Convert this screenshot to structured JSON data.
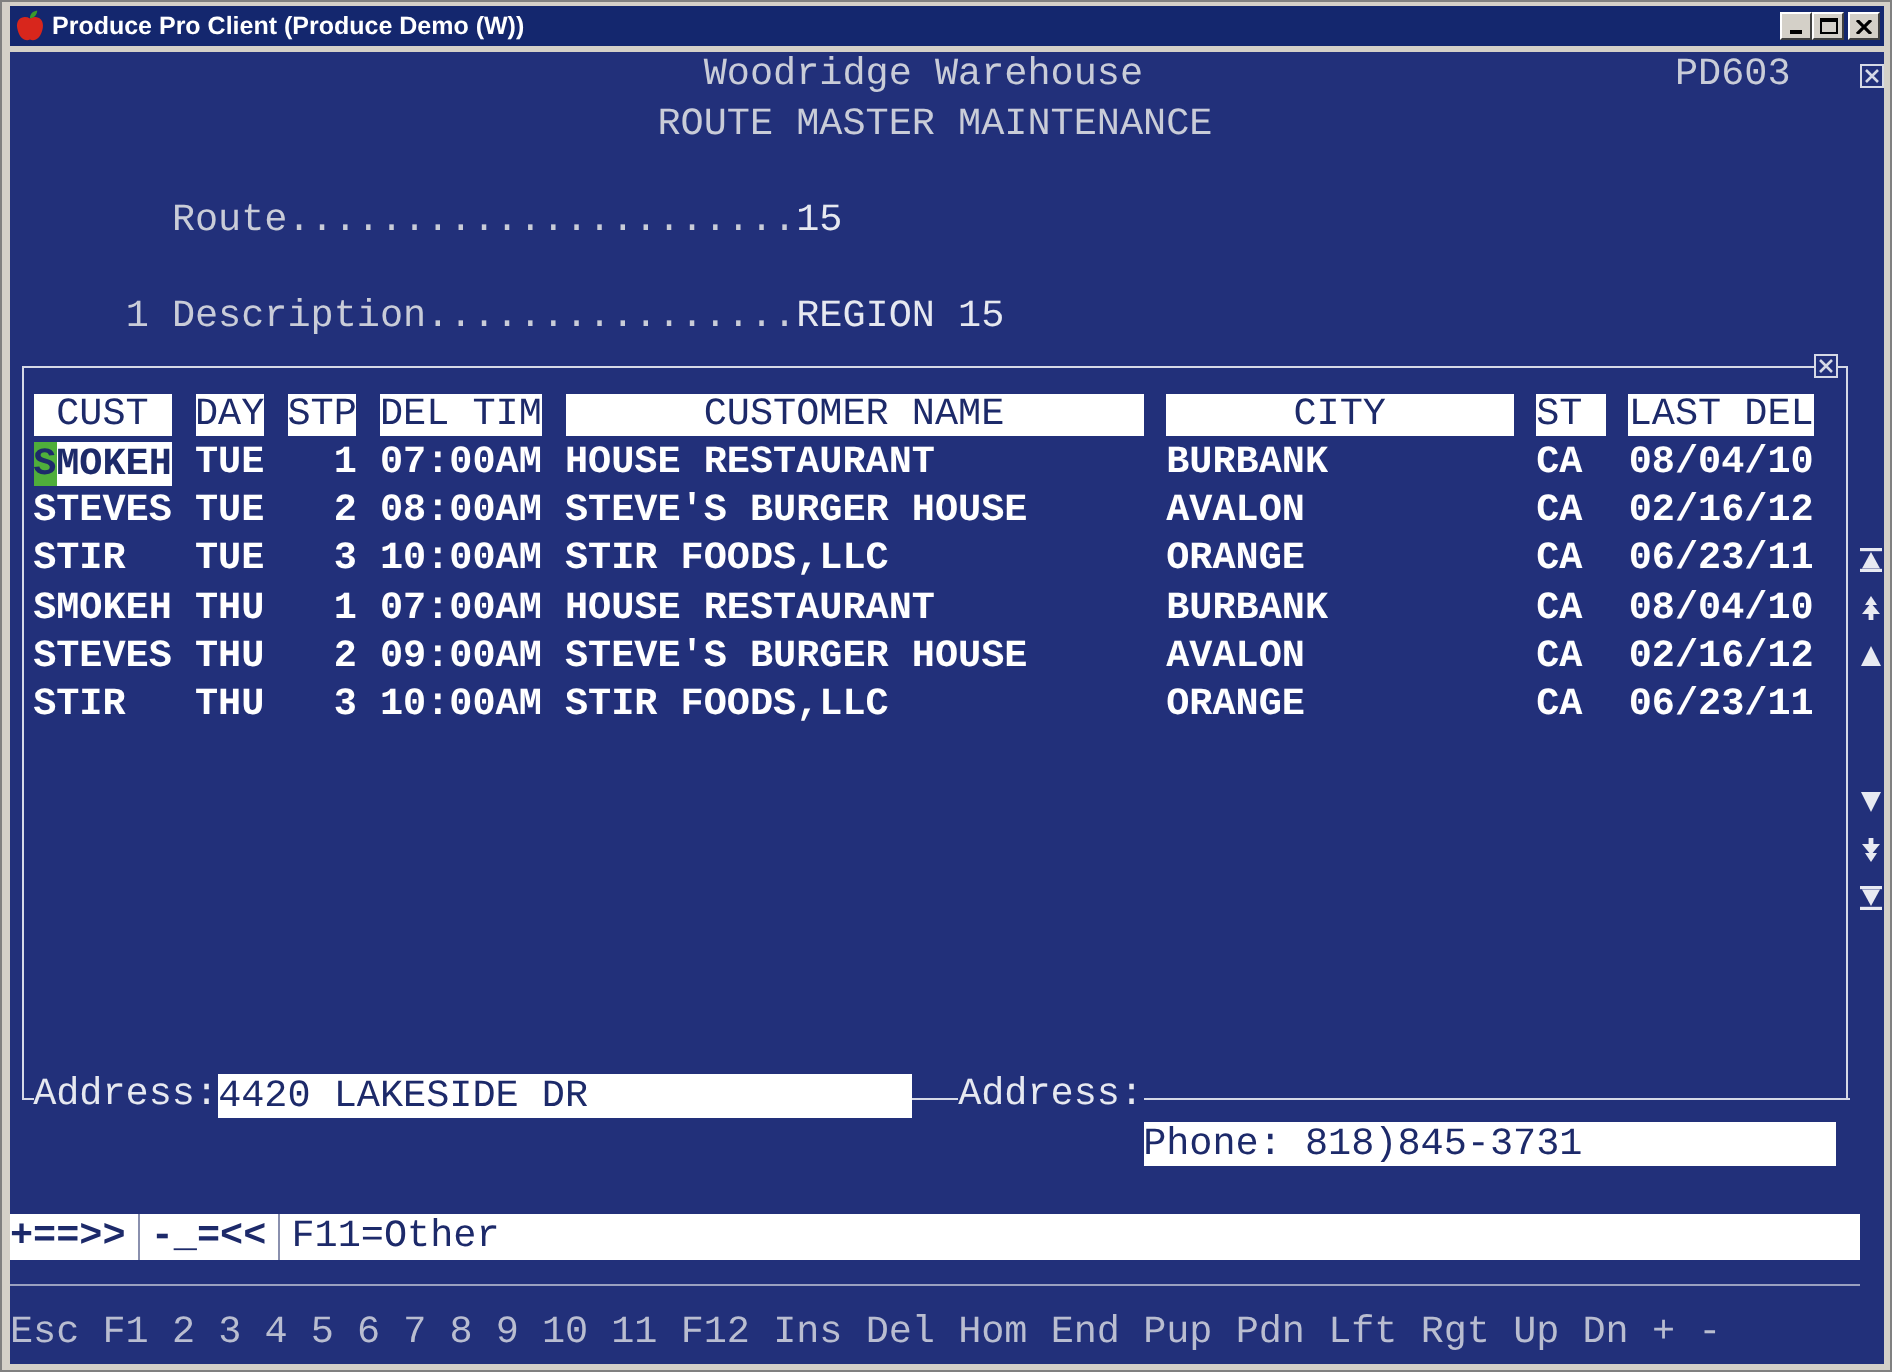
{
  "window": {
    "title": "Produce Pro Client (Produce Demo (W))"
  },
  "screen": {
    "company": "Woodridge Warehouse",
    "program_code": "PD603",
    "title": "ROUTE MASTER MAINTENANCE"
  },
  "route": {
    "label": "Route......................",
    "value": "15"
  },
  "description": {
    "number": "1",
    "label": "Description................",
    "value": "REGION 15"
  },
  "table": {
    "columns": [
      "CUST",
      "DAY",
      "STP",
      "DEL TIM",
      "CUSTOMER NAME",
      "CITY",
      "ST",
      "LAST DEL"
    ],
    "rows": [
      {
        "selected": true,
        "cells": [
          "SMOKEH",
          "TUE",
          "1",
          "07:00AM",
          "HOUSE RESTAURANT",
          "BURBANK",
          "CA",
          "08/04/10"
        ]
      },
      {
        "selected": false,
        "cells": [
          "STEVES",
          "TUE",
          "2",
          "08:00AM",
          "STEVE'S BURGER HOUSE",
          "AVALON",
          "CA",
          "02/16/12"
        ]
      },
      {
        "selected": false,
        "cells": [
          "STIR",
          "TUE",
          "3",
          "10:00AM",
          "STIR FOODS,LLC",
          "ORANGE",
          "CA",
          "06/23/11"
        ]
      },
      {
        "selected": false,
        "cells": [
          "SMOKEH",
          "THU",
          "1",
          "07:00AM",
          "HOUSE RESTAURANT",
          "BURBANK",
          "CA",
          "08/04/10"
        ]
      },
      {
        "selected": false,
        "cells": [
          "STEVES",
          "THU",
          "2",
          "09:00AM",
          "STEVE'S BURGER HOUSE",
          "AVALON",
          "CA",
          "02/16/12"
        ]
      },
      {
        "selected": false,
        "cells": [
          "STIR",
          "THU",
          "3",
          "10:00AM",
          "STIR FOODS,LLC",
          "ORANGE",
          "CA",
          "06/23/11"
        ]
      }
    ]
  },
  "address": {
    "label": "Address:",
    "value": "4420 LAKESIDE DR"
  },
  "address_2": {
    "label": "Address:"
  },
  "phone_line": "Phone: 818)845-3731",
  "commands": [
    {
      "kind": "page",
      "label": "+==>>"
    },
    {
      "kind": "page",
      "label": "-_=<<"
    },
    {
      "kind": "function",
      "label": "F11=Other"
    }
  ],
  "function_keys": [
    "Esc",
    "F1",
    "2",
    "3",
    "4",
    "5",
    "6",
    "7",
    "8",
    "9",
    "10",
    "11",
    "F12",
    "Ins",
    "Del",
    "Hom",
    "End",
    "Pup",
    "Pdn",
    "Lft",
    "Rgt",
    "Up",
    "Dn",
    "+",
    "-"
  ]
}
